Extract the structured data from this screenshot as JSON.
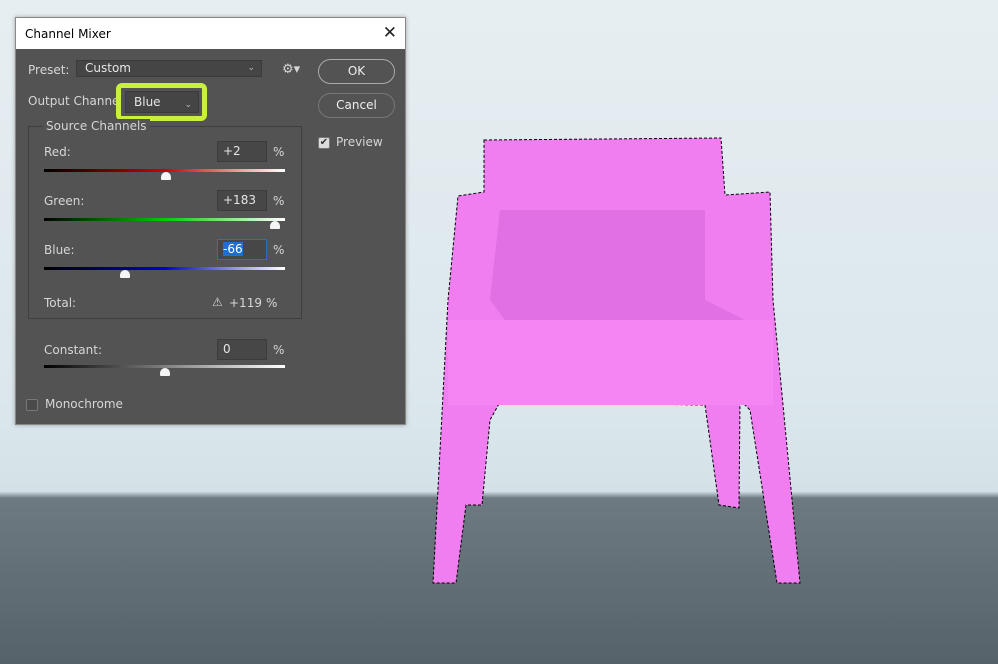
{
  "dialog": {
    "title": "Channel Mixer",
    "preset_label": "Preset:",
    "preset_value": "Custom",
    "output_label": "Output Channel:",
    "output_value": "Blue",
    "ok": "OK",
    "cancel": "Cancel",
    "preview": "Preview",
    "preview_checked": true,
    "source_label": "Source Channels",
    "channels": [
      {
        "label": "Red:",
        "value": "+2",
        "unit": "%",
        "fraction": 0.505
      },
      {
        "label": "Green:",
        "value": "+183",
        "unit": "%",
        "fraction": 0.957
      },
      {
        "label": "Blue:",
        "value": "-66",
        "unit": "%",
        "fraction": 0.335
      }
    ],
    "total_label": "Total:",
    "total_value": "+119",
    "total_unit": "%",
    "constant": {
      "label": "Constant:",
      "value": "0",
      "unit": "%",
      "fraction": 0.5
    },
    "monochrome": "Monochrome",
    "monochrome_checked": false,
    "highlight_color": "#c8f03c"
  },
  "canvas": {
    "chair_color": "#f27ef0"
  }
}
